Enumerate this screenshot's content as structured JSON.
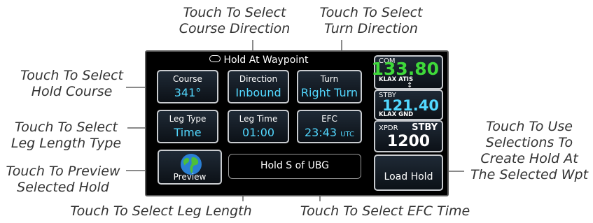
{
  "callouts": {
    "course_direction": [
      "Touch To Select",
      "Course Direction"
    ],
    "turn_direction": [
      "Touch To Select",
      "Turn Direction"
    ],
    "hold_course": [
      "Touch To Select",
      "Hold Course"
    ],
    "leg_length_type": [
      "Touch To Select",
      "Leg Length Type"
    ],
    "preview": [
      "Touch To Preview",
      "Selected Hold"
    ],
    "use_selections": [
      "Touch To Use",
      "Selections To",
      "Create Hold At",
      "The Selected Wpt"
    ],
    "leg_length": "Touch To Select Leg Length",
    "efc_time": "Touch To Select EFC Time"
  },
  "screen": {
    "title": "Hold At Waypoint",
    "buttons": {
      "course": {
        "label": "Course",
        "value": "341°"
      },
      "direction": {
        "label": "Direction",
        "value": "Inbound"
      },
      "turn": {
        "label": "Turn",
        "value": "Right Turn"
      },
      "leg_type": {
        "label": "Leg Type",
        "value": "Time"
      },
      "leg_time": {
        "label": "Leg Time",
        "value": "01:00"
      },
      "efc": {
        "label": "EFC",
        "value": "23:43",
        "unit": "UTC"
      }
    },
    "preview_label": "Preview",
    "waypoint_text": "Hold S of UBG",
    "com": {
      "tag": "COM",
      "freq": "133.80",
      "id": "KLAX ATIS"
    },
    "stby": {
      "tag": "STBY",
      "freq": "121.40",
      "id": "KLAX GND"
    },
    "xpdr": {
      "tag": "XPDR",
      "mode": "STBY",
      "code": "1200"
    },
    "load_hold": "Load Hold"
  },
  "colors": {
    "active_freq": "#3fd93a",
    "standby_value": "#52d8ff"
  }
}
